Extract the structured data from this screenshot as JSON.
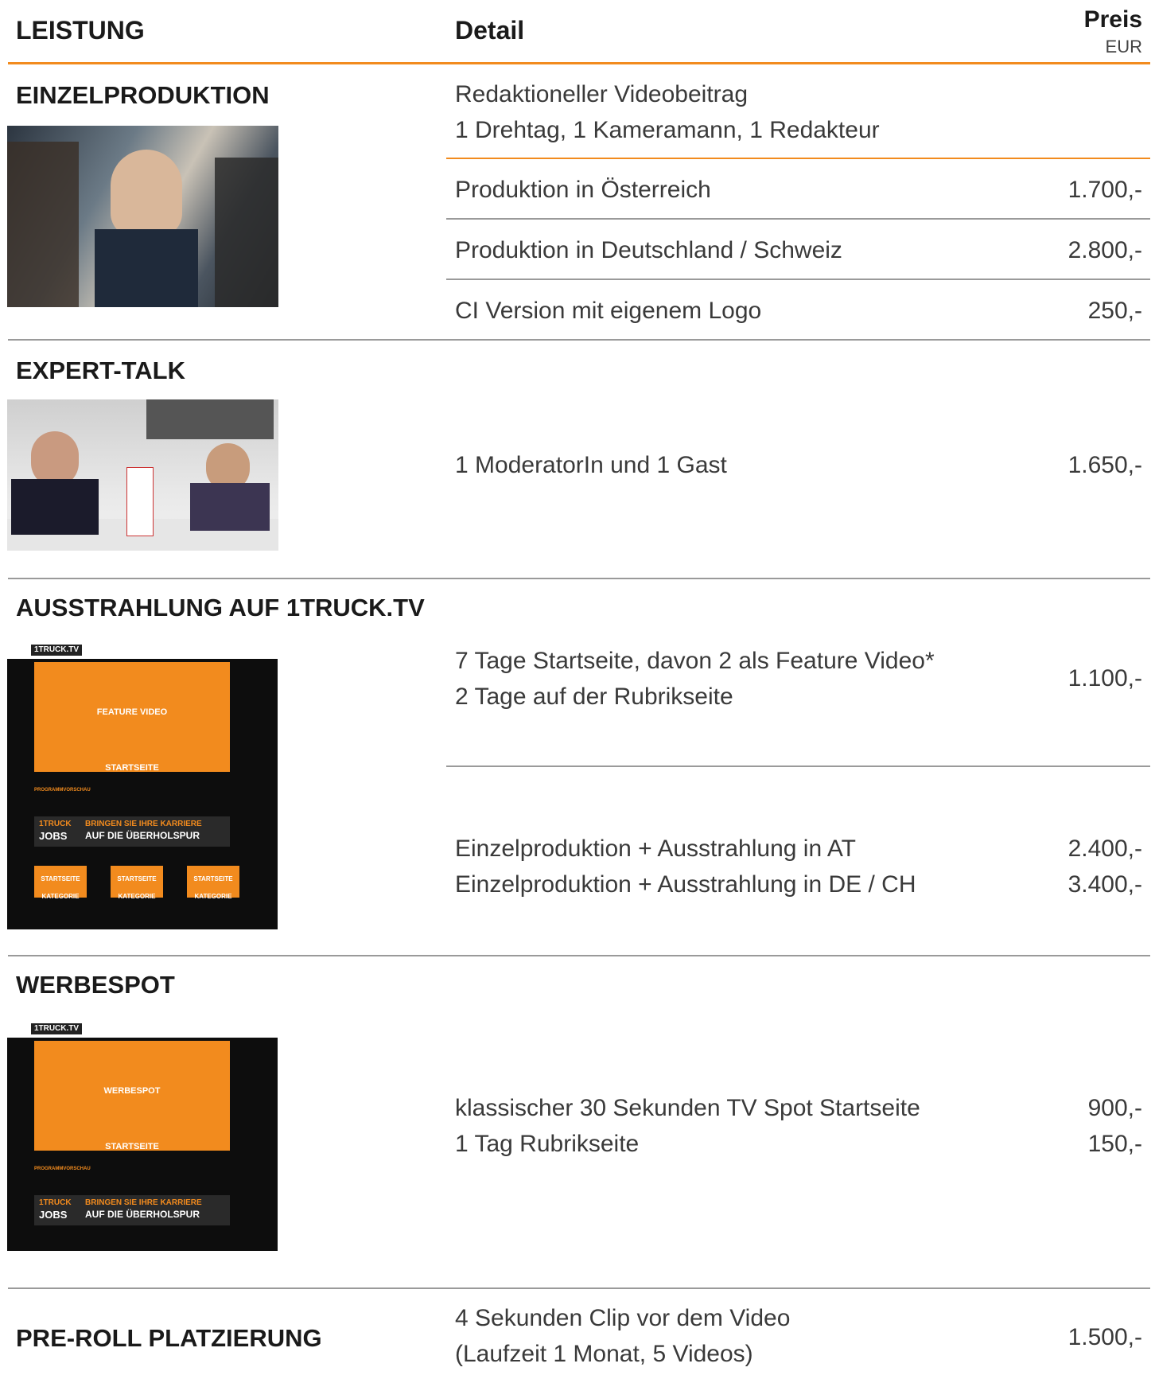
{
  "header": {
    "col1": "LEISTUNG",
    "col2": "Detail",
    "col3": "Preis",
    "currency": "EUR"
  },
  "sections": {
    "einzel": {
      "title": "EINZELPRODUKTION",
      "intro": [
        "Redaktioneller Videobeitrag",
        "1 Drehtag, 1 Kameramann, 1 Redakteur"
      ],
      "rows": [
        {
          "label": "Produktion in Österreich",
          "price": "1.700,-"
        },
        {
          "label": "Produktion in Deutschland / Schweiz",
          "price": "2.800,-"
        },
        {
          "label": "CI Version mit eigenem Logo",
          "price": "250,-"
        }
      ]
    },
    "expert": {
      "title": "EXPERT-TALK",
      "label": "1 ModeratorIn und 1 Gast",
      "price": "1.650,-"
    },
    "ausstrahlung": {
      "title": "AUSSTRAHLUNG AUF 1TRUCK.TV",
      "lines": [
        "7 Tage Startseite, davon 2 als Feature Video*",
        "2 Tage auf der Rubrikseite"
      ],
      "price": "1.100,-",
      "combo": [
        {
          "label": "Einzelproduktion + Ausstrahlung in AT",
          "price": "2.400,-"
        },
        {
          "label": "Einzelproduktion + Ausstrahlung in DE / CH",
          "price": "3.400,-"
        }
      ],
      "mock": {
        "logo": "1TRUCK.TV",
        "hero": [
          "FEATURE VIDEO",
          "STARTSEITE"
        ],
        "preview": "PROGRAMMVORSCHAU",
        "jobs": [
          "1TRUCK",
          "JOBS",
          "BRINGEN SIE IHRE KARRIERE",
          "AUF DIE ÜBERHOLSPUR"
        ],
        "tiles": [
          [
            "STARTSEITE",
            "KATEGORIE"
          ],
          [
            "STARTSEITE",
            "KATEGORIE"
          ],
          [
            "STARTSEITE",
            "KATEGORIE"
          ]
        ]
      }
    },
    "werbespot": {
      "title": "WERBESPOT",
      "rows": [
        {
          "label": "klassischer 30 Sekunden TV Spot Startseite",
          "price": "900,-"
        },
        {
          "label": "1 Tag Rubrikseite",
          "price": "150,-"
        }
      ],
      "mock": {
        "logo": "1TRUCK.TV",
        "hero": [
          "WERBESPOT",
          "STARTSEITE"
        ],
        "preview": "PROGRAMMVORSCHAU",
        "jobs": [
          "1TRUCK",
          "JOBS",
          "BRINGEN SIE IHRE KARRIERE",
          "AUF DIE ÜBERHOLSPUR"
        ]
      }
    },
    "preroll": {
      "title": "PRE-ROLL PLATZIERUNG",
      "lines": [
        "4 Sekunden Clip vor dem Video",
        "(Laufzeit 1 Monat, 5 Videos)"
      ],
      "price": "1.500,-"
    }
  },
  "colors": {
    "accent": "#f28b1e",
    "rule": "#9a9a9a",
    "text": "#333333"
  }
}
